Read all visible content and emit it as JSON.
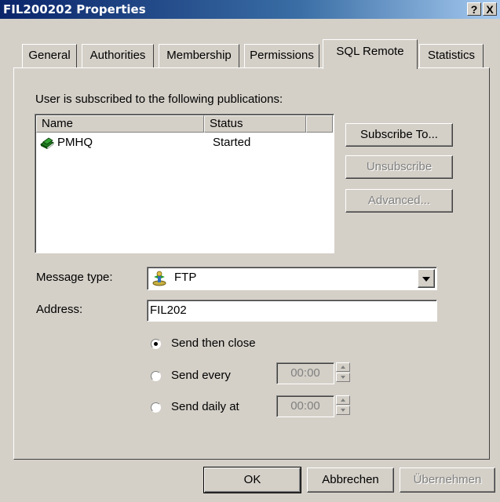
{
  "window": {
    "title": "FIL200202 Properties",
    "help_glyph": "?",
    "close_glyph": "X"
  },
  "tabs": [
    {
      "label": "General"
    },
    {
      "label": "Authorities"
    },
    {
      "label": "Membership"
    },
    {
      "label": "Permissions"
    },
    {
      "label": "SQL Remote",
      "active": true
    },
    {
      "label": "Statistics"
    }
  ],
  "subscriptions": {
    "caption": "User is subscribed to the following publications:",
    "columns": [
      "Name",
      "Status"
    ],
    "rows": [
      {
        "name": "PMHQ",
        "status": "Started",
        "icon": "publication-book-icon"
      }
    ],
    "buttons": {
      "subscribe": "Subscribe To...",
      "unsubscribe": "Unsubscribe",
      "advanced": "Advanced..."
    }
  },
  "message_type": {
    "label": "Message type:",
    "value": "FTP",
    "icon": "ftp-icon"
  },
  "address": {
    "label": "Address:",
    "value": "FIL202"
  },
  "send_options": {
    "then_close": "Send then close",
    "every": "Send every",
    "every_time": "00:00",
    "daily": "Send daily at",
    "daily_time": "00:00",
    "selected": "then_close"
  },
  "footer": {
    "ok": "OK",
    "cancel": "Abbrechen",
    "apply": "Übernehmen"
  }
}
